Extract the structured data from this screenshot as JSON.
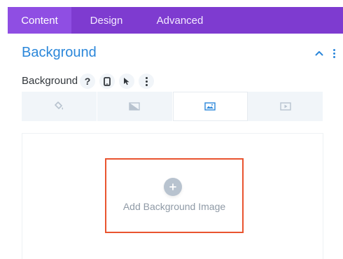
{
  "tabs": [
    {
      "label": "Content",
      "active": true
    },
    {
      "label": "Design",
      "active": false
    },
    {
      "label": "Advanced",
      "active": false
    }
  ],
  "section": {
    "title": "Background",
    "collapse_icon": "chevron-up-icon",
    "more_icon": "vertical-ellipsis-icon"
  },
  "field": {
    "label": "Background",
    "help_icon": "question-icon",
    "help_text": "?",
    "responsive_icon": "phone-icon",
    "hover_icon": "cursor-icon",
    "more_icon": "vertical-ellipsis-icon"
  },
  "background_tabs": [
    {
      "icon": "paint-bucket-icon",
      "active": false
    },
    {
      "icon": "gradient-icon",
      "active": false
    },
    {
      "icon": "image-icon",
      "active": true
    },
    {
      "icon": "video-icon",
      "active": false
    }
  ],
  "upload": {
    "label": "Add Background Image",
    "icon": "plus-icon"
  },
  "colors": {
    "tab_bar": "#7e3bd0",
    "tab_active": "#8f4ee3",
    "accent_blue": "#2b87da",
    "highlight": "#e9542f"
  }
}
